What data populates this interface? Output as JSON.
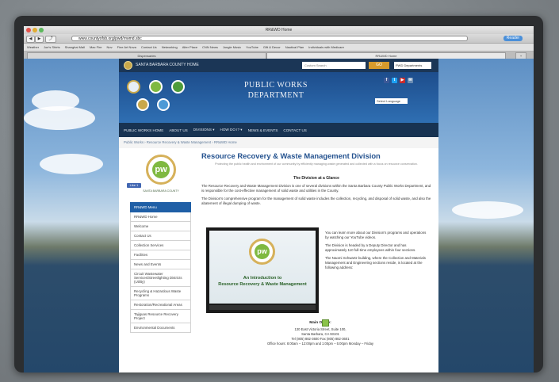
{
  "browser": {
    "window_title": "RR&WD Home",
    "url": "www.countyofsb.org/pwd/rrwmd.sbc",
    "reader_label": "Reader",
    "bookmarks": [
      "Weather",
      "Joe's Shirts",
      "Shanghai Mall",
      "Mac Fire",
      "Nov",
      "Fine Art Nova",
      "Contact Us",
      "Networking",
      "Alter Place",
      "CNN News",
      "Jungle Music",
      "YouTube",
      "Gift & Decor",
      "Nautical Plan",
      "Individuals with Medicare"
    ],
    "tabs": [
      "Dispensaries",
      "RR&WD Home"
    ],
    "nav_back": "◀",
    "nav_forward": "▶",
    "share_icon": "⤴",
    "new_tab_icon": "+"
  },
  "site": {
    "county_link": "SANTA BARBARA COUNTY HOME",
    "search_placeholder": "Custom Search",
    "search_button": "GO",
    "dept_select": "PWD Departments",
    "banner_title": "PUBLIC WORKS\nDEPARTMENT",
    "language_select": "Select Language",
    "social": [
      "f",
      "t",
      "▶",
      "✉"
    ],
    "nav": [
      "PUBLIC WORKS HOME",
      "ABOUT US",
      "DIVISIONS ▾",
      "HOW DO I? ▾",
      "NEWS & EVENTS",
      "CONTACT US"
    ],
    "breadcrumb": "Public Works  ›  Resource Recovery & Waste Management  ›  RR&WD Home",
    "pw_logo_text": "pw",
    "pw_caption": "SANTA BARBARA COUNTY",
    "like_label": "Like 1",
    "menu": [
      "RR&WD Menu",
      "RR&WD Home",
      "Welcome",
      "Contact Us",
      "Collection Services",
      "Facilities",
      "News and Events",
      "Circuit Wastewater Services/Streetlighting Districts (Utility)",
      "Recycling & Hazardous Waste Programs",
      "Restoration/Recreational Areas",
      "Tajiguas Resource Recovery Project",
      "Environmental Documents"
    ],
    "main": {
      "heading": "Resource Recovery & Waste Management Division",
      "subheading": "Protecting the public health and environment of our community by efficiently managing waste generated and collected with a focus on resource conservation.",
      "glance_heading": "The Division at a Glance",
      "para1": "The Resource Recovery and Waste Management Division is one of several divisions within the Santa Barbara County Public Works Department, and is responsible for the cost-effective management of solid waste and utilities in the County.",
      "para2": "The Division's comprehensive program for the management of solid waste includes the collection, recycling, and disposal of solid waste, and also the abatement of illegal dumping of waste.",
      "side1": "You can learn more about our Division's programs and operations by watching our YouTube videos.",
      "side2": "The Division is headed by a Deputy Director and has approximately 110 full-time employees within four sections.",
      "side3": "The Naomi Schwartz building, where the Collection and Materials Management and Engineering sections reside, is located at the following address:",
      "video_title": "An Introduction to\nResource Recovery & Waste Management",
      "office_heading": "Main Office:",
      "office_address": "130 East Victoria Street, Suite 100,\nSanta Barbara, CA 93101\nTel (805) 882-3600 Fax (805) 882-3601\nOffice hours: 8:00am – 12:00pm and 1:00pm – 5:00pm Monday – Friday"
    }
  },
  "colors": {
    "banner": "#2f6fb3",
    "navbar": "#183352",
    "heading": "#24528f",
    "accent": "#7fb941"
  }
}
